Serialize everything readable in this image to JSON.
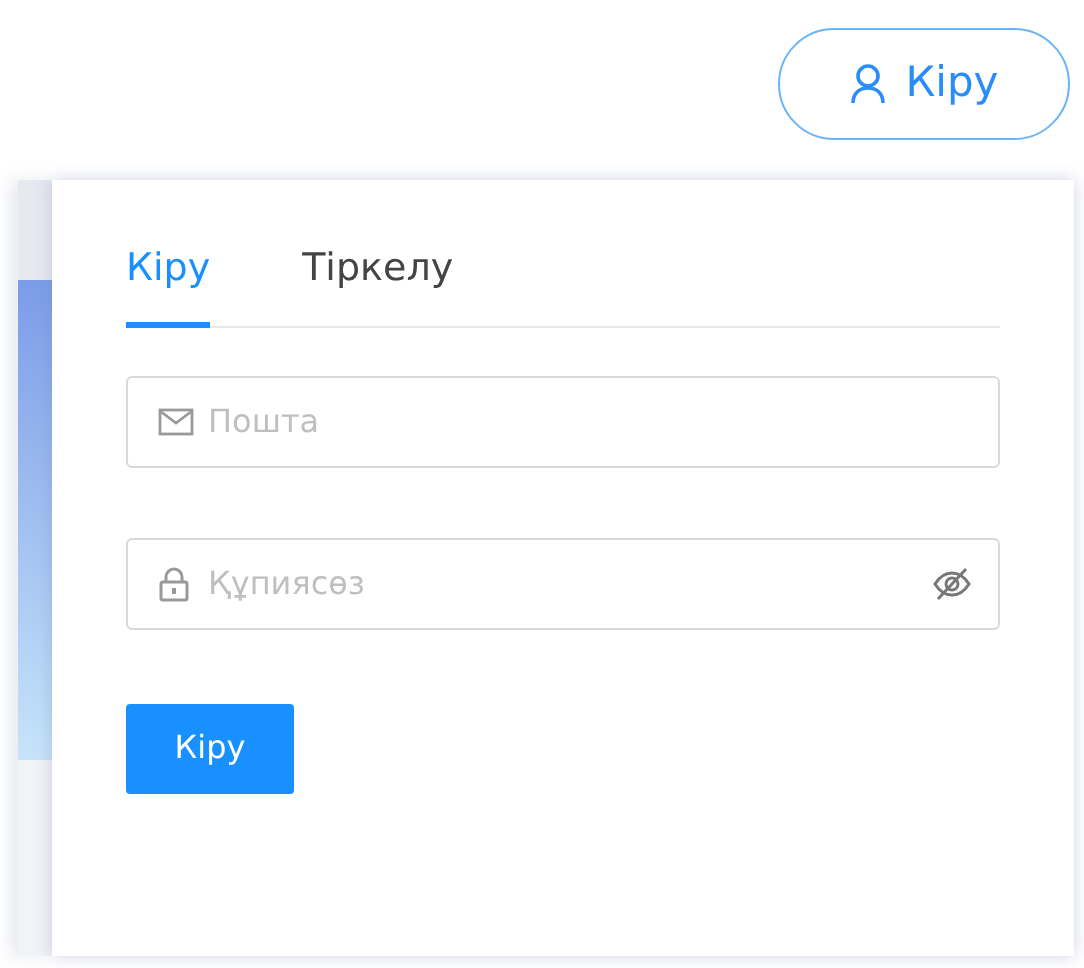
{
  "header": {
    "login_button": "Кіру"
  },
  "tabs": [
    {
      "label": "Кіру",
      "selected": true
    },
    {
      "label": "Тіркелу",
      "selected": false
    }
  ],
  "fields": [
    {
      "kind": "email",
      "placeholder": "Пошта"
    },
    {
      "kind": "password",
      "placeholder": "Құпиясөз"
    }
  ],
  "submit_button": "Кіру"
}
